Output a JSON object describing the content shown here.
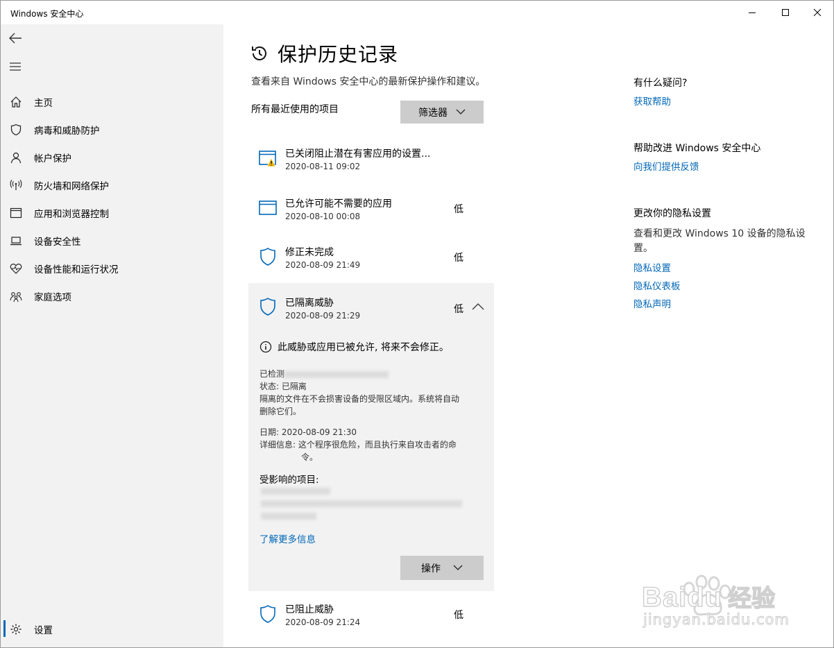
{
  "window": {
    "title": "Windows 安全中心"
  },
  "sidebar": {
    "items": [
      {
        "label": "主页",
        "icon": "home-icon"
      },
      {
        "label": "病毒和威胁防护",
        "icon": "shield-icon"
      },
      {
        "label": "帐户保护",
        "icon": "person-icon"
      },
      {
        "label": "防火墙和网络保护",
        "icon": "wireless-icon"
      },
      {
        "label": "应用和浏览器控制",
        "icon": "browser-window-icon"
      },
      {
        "label": "设备安全性",
        "icon": "laptop-icon"
      },
      {
        "label": "设备性能和运行状况",
        "icon": "heart-pulse-icon"
      },
      {
        "label": "家庭选项",
        "icon": "family-icon"
      }
    ],
    "settings_label": "设置"
  },
  "main": {
    "title": "保护历史记录",
    "subtitle": "查看来自 Windows 安全中心的最新保护操作和建议。",
    "section_label": "所有最近使用的项目",
    "filter_label": "筛选器",
    "items": [
      {
        "title": "已关闭阻止潜在有害应用的设置...",
        "date": "2020-08-11 09:02",
        "severity": "",
        "icon": "app-window-warning-icon"
      },
      {
        "title": "已允许可能不需要的应用",
        "date": "2020-08-10 00:08",
        "severity": "低",
        "icon": "app-window-icon"
      },
      {
        "title": "修正未完成",
        "date": "2020-08-09 21:49",
        "severity": "低",
        "icon": "shield-icon"
      }
    ],
    "expanded": {
      "title": "已隔离威胁",
      "date": "2020-08-09 21:29",
      "severity": "低",
      "info": "此威胁或应用已被允许, 将来不会修正。",
      "detected_prefix": "已检测",
      "status": "状态: 已隔离",
      "quarantine_desc_1": "隔离的文件在不会损害设备的受限区域内。系统将自动",
      "quarantine_desc_2": "删除它们。",
      "date_line": "日期:  2020-08-09 21:30",
      "details_1": "详细信息: 这个程序很危险，而且执行来自攻击者的命",
      "details_2": "令。",
      "affected_label": "受影响的项目:",
      "more_link": "了解更多信息",
      "action_label": "操作"
    },
    "last_item": {
      "title": "已阻止威胁",
      "date": "2020-08-09 21:24",
      "severity": "低"
    }
  },
  "right": {
    "question_head": "有什么疑问?",
    "help_link": "获取帮助",
    "improve_head": "帮助改进 Windows 安全中心",
    "feedback_link": "向我们提供反馈",
    "privacy_head": "更改你的隐私设置",
    "privacy_text": "查看和更改 Windows 10 设备的隐私设置。",
    "privacy_settings_link": "隐私设置",
    "privacy_dashboard_link": "隐私仪表板",
    "privacy_statement_link": "隐私声明"
  },
  "watermark": {
    "brand": "Baidu",
    "cn": "经验",
    "url": "jingyan.baidu.com"
  },
  "colors": {
    "accent": "#0067b8",
    "sidebar_bg": "#f2f2f2",
    "button_bg": "#cccccc",
    "warning": "#e8b100"
  }
}
